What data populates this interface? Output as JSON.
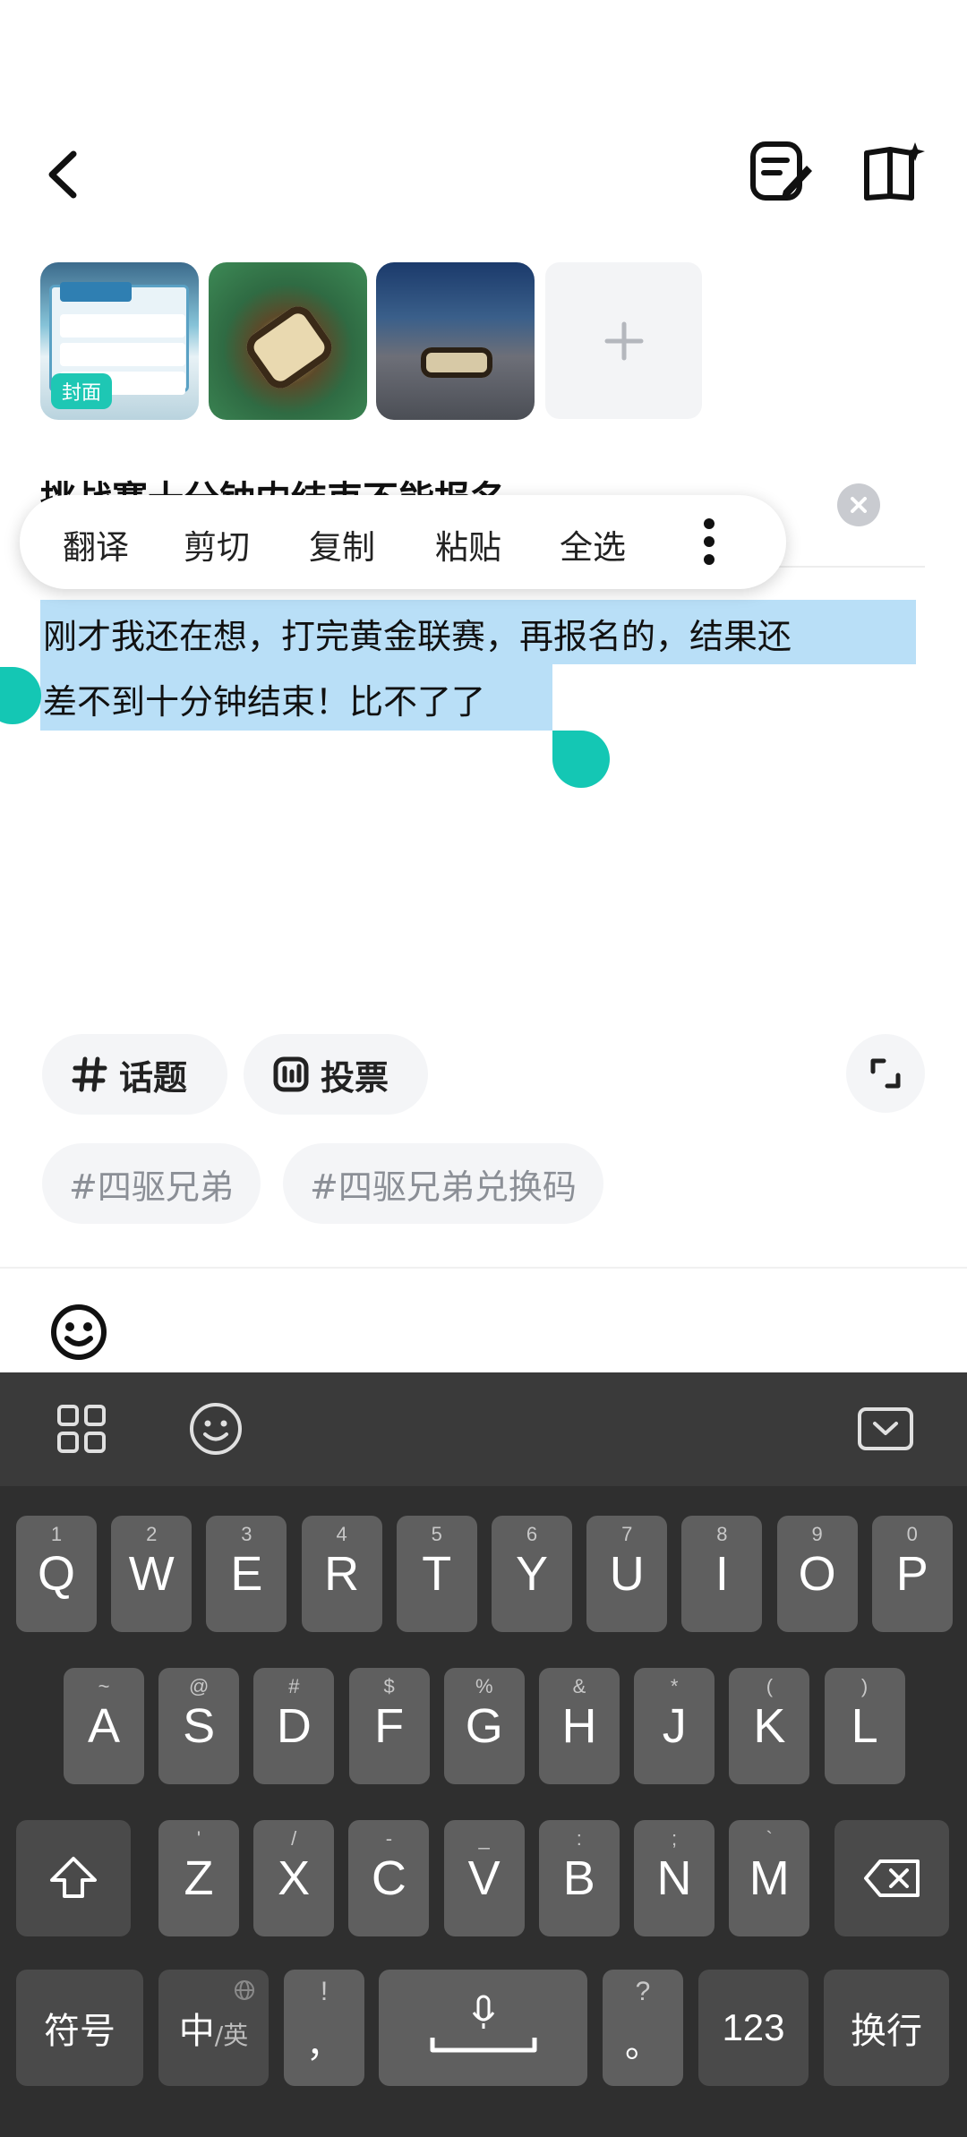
{
  "header": {
    "back_icon": "back-arrow-icon",
    "draft_icon": "draft-edit-icon",
    "guide_icon": "book-sparkle-icon"
  },
  "media": {
    "cover_label": "封面",
    "add_label": "+"
  },
  "post": {
    "title": "挑战赛十分钟内结束不能报名",
    "body_line1": "刚才我还在想，打完黄金联赛，再报名的，结果还",
    "body_line2": "差不到十分钟结束！比不了了"
  },
  "context_menu": {
    "items": [
      "翻译",
      "剪切",
      "复制",
      "粘贴",
      "全选"
    ]
  },
  "toolbar": {
    "topic_label": "话题",
    "vote_label": "投票"
  },
  "suggested_tags": [
    "#四驱兄弟",
    "#四驱兄弟兑换码"
  ],
  "keyboard": {
    "row1": [
      {
        "sub": "1",
        "main": "Q"
      },
      {
        "sub": "2",
        "main": "W"
      },
      {
        "sub": "3",
        "main": "E"
      },
      {
        "sub": "4",
        "main": "R"
      },
      {
        "sub": "5",
        "main": "T"
      },
      {
        "sub": "6",
        "main": "Y"
      },
      {
        "sub": "7",
        "main": "U"
      },
      {
        "sub": "8",
        "main": "I"
      },
      {
        "sub": "9",
        "main": "O"
      },
      {
        "sub": "0",
        "main": "P"
      }
    ],
    "row2": [
      {
        "sub": "~",
        "main": "A"
      },
      {
        "sub": "@",
        "main": "S"
      },
      {
        "sub": "#",
        "main": "D"
      },
      {
        "sub": "$",
        "main": "F"
      },
      {
        "sub": "%",
        "main": "G"
      },
      {
        "sub": "&",
        "main": "H"
      },
      {
        "sub": "*",
        "main": "J"
      },
      {
        "sub": "(",
        "main": "K"
      },
      {
        "sub": ")",
        "main": "L"
      }
    ],
    "row3": [
      {
        "sub": "'",
        "main": "Z"
      },
      {
        "sub": "/",
        "main": "X"
      },
      {
        "sub": "-",
        "main": "C"
      },
      {
        "sub": "_",
        "main": "V"
      },
      {
        "sub": ":",
        "main": "B"
      },
      {
        "sub": ";",
        "main": "N"
      },
      {
        "sub": "`",
        "main": "M"
      }
    ],
    "symbols_label": "符号",
    "lang_main": "中",
    "lang_sub": "/英",
    "comma_sub": "!",
    "comma_main": "，",
    "period_sub": "?",
    "period_main": "。",
    "num_label": "123",
    "enter_label": "换行"
  }
}
